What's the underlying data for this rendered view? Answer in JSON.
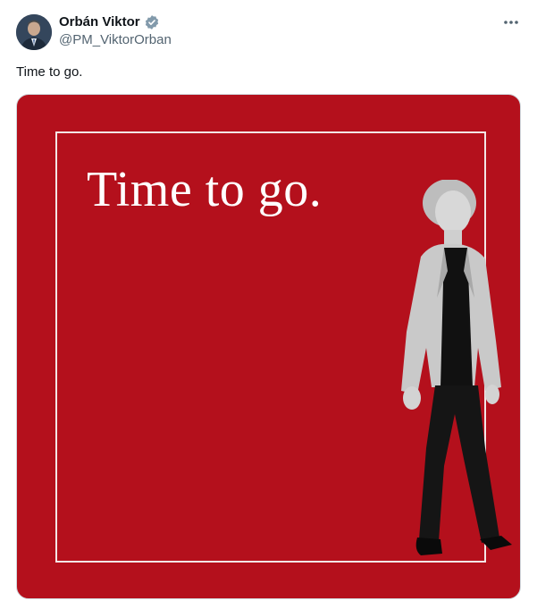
{
  "author": {
    "display_name": "Orbán Viktor",
    "handle": "@PM_ViktorOrban",
    "verified": true,
    "avatar_icon": "user-avatar"
  },
  "more_icon": "more-options-icon",
  "tweet": {
    "text": "Time to go."
  },
  "media": {
    "headline": "Time to go.",
    "background_color": "#b4101c",
    "frame_color": "#f3e6e6",
    "subject": "walking-woman-figure"
  }
}
